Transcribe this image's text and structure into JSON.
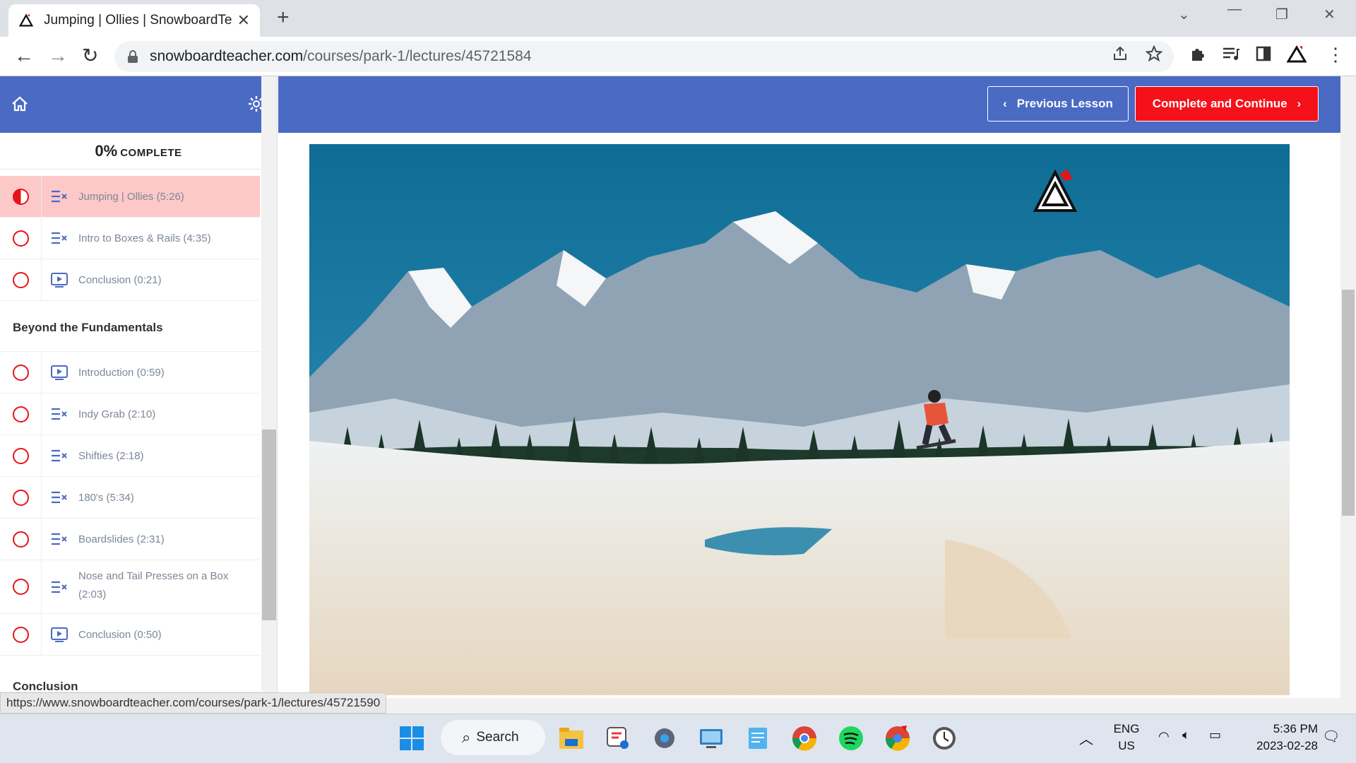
{
  "browser": {
    "tab_title": "Jumping | Ollies | SnowboardTeac",
    "url_host": "snowboardteacher.com",
    "url_path": "/courses/park-1/lectures/45721584",
    "status_url": "https://www.snowboardteacher.com/courses/park-1/lectures/45721590"
  },
  "sidebar": {
    "progress_pct": "0%",
    "progress_label": "COMPLETE",
    "lessons_top": [
      {
        "label": "Jumping | Ollies (5:26)",
        "icon": "quiz-list-icon",
        "state": "in-progress"
      },
      {
        "label": "Intro to Boxes & Rails (4:35)",
        "icon": "quiz-list-icon",
        "state": "incomplete"
      },
      {
        "label": "Conclusion (0:21)",
        "icon": "video-play-icon",
        "state": "incomplete"
      }
    ],
    "section_title": "Beyond the Fundamentals",
    "lessons_section": [
      {
        "label": "Introduction (0:59)",
        "icon": "video-play-icon"
      },
      {
        "label": "Indy Grab (2:10)",
        "icon": "quiz-list-icon"
      },
      {
        "label": "Shifties (2:18)",
        "icon": "quiz-list-icon"
      },
      {
        "label": "180's (5:34)",
        "icon": "quiz-list-icon"
      },
      {
        "label": "Boardslides (2:31)",
        "icon": "quiz-list-icon"
      },
      {
        "label": "Nose and Tail Presses on a Box (2:03)",
        "icon": "quiz-list-icon"
      },
      {
        "label": "Conclusion (0:50)",
        "icon": "video-play-icon"
      }
    ],
    "next_section_partial": "Conclusion"
  },
  "header": {
    "prev_label": "Previous Lesson",
    "next_label": "Complete and Continue"
  },
  "taskbar": {
    "search_label": "Search",
    "lang_top": "ENG",
    "lang_bottom": "US",
    "time": "5:36 PM",
    "date": "2023-02-28"
  },
  "colors": {
    "brand_blue": "#4a6ac4",
    "accent_red": "#f5111a",
    "active_lesson_bg": "#fdc8c8"
  }
}
